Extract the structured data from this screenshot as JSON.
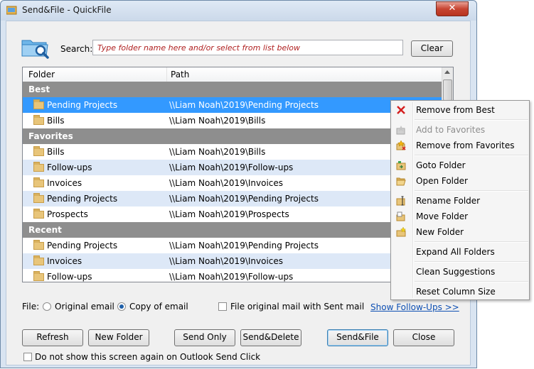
{
  "window": {
    "title": "Send&File - QuickFile",
    "close_glyph": "✕"
  },
  "search": {
    "label": "Search:",
    "placeholder": "Type folder name here and/or select from list below",
    "value": "",
    "clear_label": "Clear"
  },
  "list": {
    "columns": [
      "Folder",
      "Path"
    ],
    "groups": [
      {
        "label": "Best",
        "rows": [
          {
            "folder": "Pending Projects",
            "path": "\\\\Liam Noah\\2019\\Pending Projects",
            "selected": true
          },
          {
            "folder": "Bills",
            "path": "\\\\Liam Noah\\2019\\Bills"
          }
        ]
      },
      {
        "label": "Favorites",
        "rows": [
          {
            "folder": "Bills",
            "path": "\\\\Liam Noah\\2019\\Bills"
          },
          {
            "folder": "Follow-ups",
            "path": "\\\\Liam Noah\\2019\\Follow-ups"
          },
          {
            "folder": "Invoices",
            "path": "\\\\Liam Noah\\2019\\Invoices"
          },
          {
            "folder": "Pending Projects",
            "path": "\\\\Liam Noah\\2019\\Pending Projects"
          },
          {
            "folder": "Prospects",
            "path": "\\\\Liam Noah\\2019\\Prospects"
          }
        ]
      },
      {
        "label": "Recent",
        "rows": [
          {
            "folder": "Pending Projects",
            "path": "\\\\Liam Noah\\2019\\Pending Projects"
          },
          {
            "folder": "Invoices",
            "path": "\\\\Liam Noah\\2019\\Invoices"
          },
          {
            "folder": "Follow-ups",
            "path": "\\\\Liam Noah\\2019\\Follow-ups"
          }
        ]
      }
    ]
  },
  "file_options": {
    "label": "File:",
    "original_email": "Original email",
    "copy_of_email": "Copy of email",
    "selected": "copy_of_email",
    "file_with_sent": "File original mail with Sent mail",
    "file_with_sent_checked": false,
    "show_followups": "Show Follow-Ups >>"
  },
  "buttons": {
    "refresh": "Refresh",
    "new_folder": "New Folder",
    "send_only": "Send Only",
    "send_delete": "Send&Delete",
    "send_file": "Send&File",
    "close": "Close"
  },
  "footer": {
    "dont_show": "Do not show this screen again on Outlook Send Click",
    "dont_show_checked": false
  },
  "context_menu": {
    "items": [
      {
        "label": "Remove from Best",
        "icon": "red-x-icon",
        "enabled": true
      },
      {
        "label": "Add to Favorites",
        "icon": "add-favorite-icon",
        "enabled": false
      },
      {
        "label": "Remove from Favorites",
        "icon": "remove-favorite-icon",
        "enabled": true
      },
      {
        "label": "Goto Folder",
        "icon": "goto-folder-icon",
        "enabled": true
      },
      {
        "label": "Open Folder",
        "icon": "open-folder-icon",
        "enabled": true
      },
      {
        "label": "Rename Folder",
        "icon": "rename-folder-icon",
        "enabled": true
      },
      {
        "label": "Move Folder",
        "icon": "move-folder-icon",
        "enabled": true
      },
      {
        "label": "New Folder",
        "icon": "new-folder-icon",
        "enabled": true
      },
      {
        "label": "Expand All Folders",
        "icon": "",
        "enabled": true
      },
      {
        "label": "Clean Suggestions",
        "icon": "",
        "enabled": true
      },
      {
        "label": "Reset Column Size",
        "icon": "",
        "enabled": true
      }
    ]
  },
  "colors": {
    "selection": "#3399ff",
    "group_header": "#8e8e8e",
    "alt_row": "#dde8f7",
    "link": "#0d4fb3",
    "placeholder": "#b02020"
  }
}
